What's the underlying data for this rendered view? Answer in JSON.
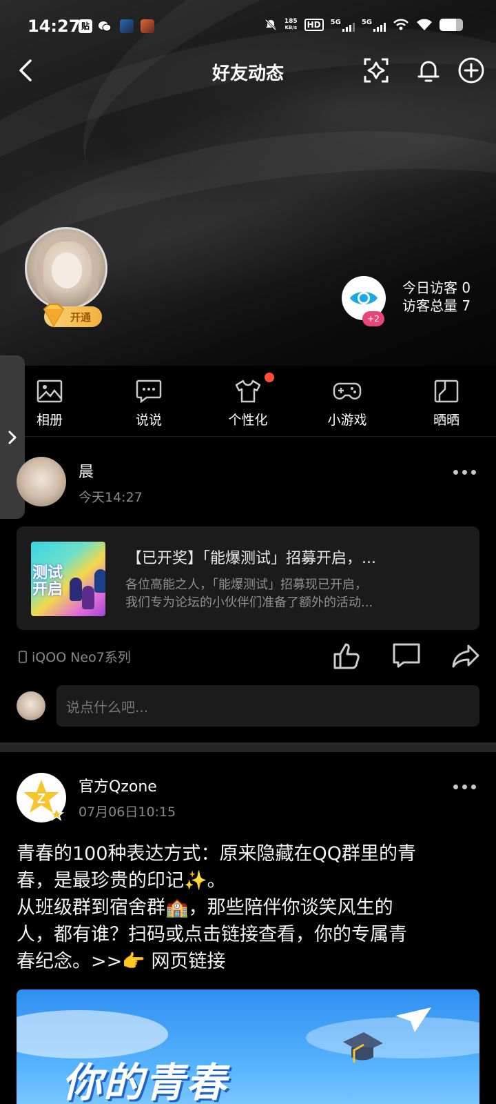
{
  "status_bar": {
    "time": "14:27",
    "speed_value": "185",
    "speed_unit": "KB/s",
    "hd_label": "HD",
    "net1": "5G",
    "net2": "5G",
    "battery_level": 0.7
  },
  "header": {
    "title": "好友动态"
  },
  "profile": {
    "vip_label": "开通",
    "visitor_badge": "+2",
    "today_visitors": "今日访客 0",
    "total_visitors": "访客总量 7"
  },
  "shortcuts": [
    {
      "label": "相册",
      "icon": "album-icon"
    },
    {
      "label": "说说",
      "icon": "chat-bubble-icon"
    },
    {
      "label": "个性化",
      "icon": "tshirt-icon",
      "badge": true
    },
    {
      "label": "小游戏",
      "icon": "gamepad-icon"
    },
    {
      "label": "晒晒",
      "icon": "showcase-icon"
    }
  ],
  "post1": {
    "author": "晨",
    "time": "今天14:27",
    "link_title": "【已开奖】「能爆测试」招募开启，...",
    "link_desc_line1": "各位高能之人，「能爆测试」招募现已开启，",
    "link_desc_line2": "我们专为论坛的小伙伴们准备了额外的活动...",
    "thumb_text_line1": "测试",
    "thumb_text_line2": "开启",
    "device": "iQOO Neo7系列",
    "comment_placeholder": "说点什么吧..."
  },
  "post2": {
    "author": "官方Qzone",
    "time": "07月06日10:15",
    "body_line1": "青春的100种表达方式：原来隐藏在QQ群里的青",
    "body_line2": "春，是最珍贵的印记✨。",
    "body_line3": "从班级群到宿舍群🏫，那些陪伴你谈笑风生的",
    "body_line4": "人，都有谁？扫码或点击链接查看，你的专属青",
    "body_line5_prefix": "春纪念。>>👉 ",
    "body_link": "网页链接",
    "banner_title": "你的青春"
  },
  "colors": {
    "background": "#000000",
    "vip_gold": "#f4b13d",
    "badge_pink": "#e8457a",
    "red_dot": "#ff4d3a",
    "banner_blue": "#2f8ff0"
  }
}
